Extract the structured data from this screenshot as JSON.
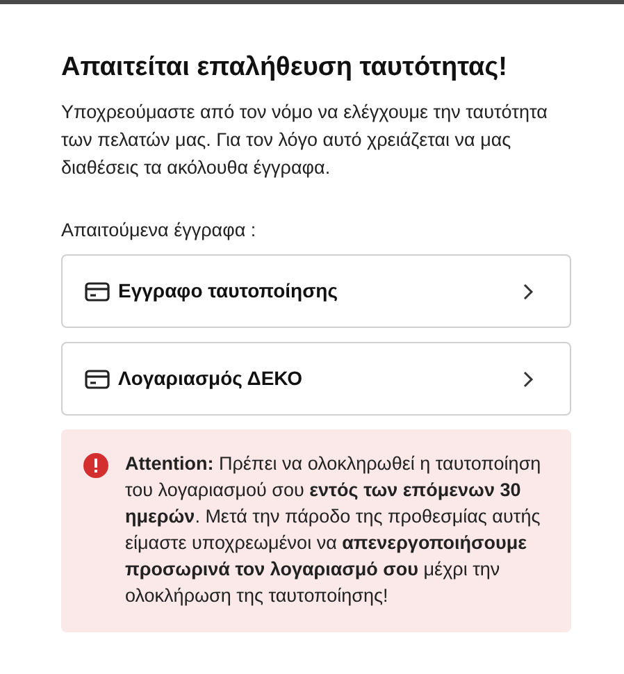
{
  "title": "Απαιτείται επαλήθευση ταυτότητας!",
  "intro": "Υποχρεούμαστε από τον νόμο να ελέγχουμε την ταυτότητα των πελατών μας. Για τον λόγο αυτό χρειάζεται να μας διαθέσεις τα ακόλουθα έγγραφα.",
  "documents_label": "Απαιτούμενα έγγραφα :",
  "documents": [
    {
      "label": "Εγγραφο ταυτοποίησης"
    },
    {
      "label": "Λογαριασμός ΔΕΚΟ"
    }
  ],
  "alert": {
    "text": "**Attention:** Πρέπει να ολοκληρωθεί η ταυτοποίηση του λογαριασμού σου **εντός των επόμενων 30 ημερών**. Μετά την πάροδο της προθεσμίας αυτής είμαστε υποχρεωμένοι να **απενεργοποιήσουμε προσωρινά τον λογαριασμό σου** μέχρι την ολοκλήρωση της ταυτοποίησης!"
  }
}
